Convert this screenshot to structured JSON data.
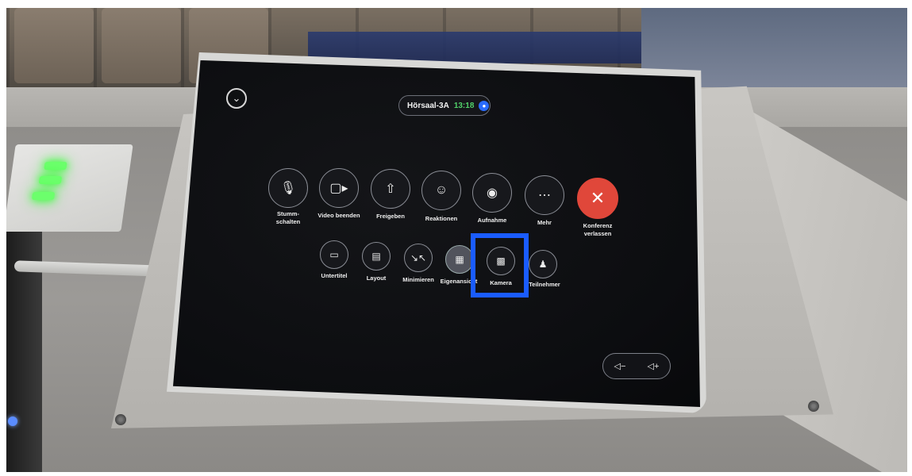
{
  "status": {
    "room": "Hörsaal-3A",
    "time": "13:18",
    "indicator_icon": "circle-dot-icon"
  },
  "top_controls": [
    {
      "id": "mute",
      "label": "Stumm-\nschalten",
      "icon": "microphone-icon"
    },
    {
      "id": "video",
      "label": "Video beenden",
      "icon": "video-camera-icon"
    },
    {
      "id": "share",
      "label": "Freigeben",
      "icon": "share-icon"
    },
    {
      "id": "reactions",
      "label": "Reaktionen",
      "icon": "smiley-icon"
    },
    {
      "id": "record",
      "label": "Aufnahme",
      "icon": "record-icon"
    },
    {
      "id": "more",
      "label": "Mehr",
      "icon": "ellipsis-icon"
    },
    {
      "id": "leave",
      "label": "Konferenz\nverlassen",
      "icon": "close-icon"
    }
  ],
  "bottom_controls": [
    {
      "id": "captions",
      "label": "Untertitel",
      "icon": "captions-icon"
    },
    {
      "id": "layout",
      "label": "Layout",
      "icon": "layout-icon"
    },
    {
      "id": "minimize",
      "label": "Minimieren",
      "icon": "minimize-icon"
    },
    {
      "id": "selfview",
      "label": "Eigenansicht",
      "icon": "self-view-icon"
    },
    {
      "id": "camera",
      "label": "Kamera",
      "icon": "camera-icon"
    },
    {
      "id": "participants",
      "label": "Teilnehmer",
      "icon": "person-icon"
    }
  ],
  "volume": {
    "down_icon": "volume-down-icon",
    "up_icon": "volume-up-icon"
  },
  "colors": {
    "leave_button": "#e0473a",
    "time_text": "#51d26a",
    "highlight_box": "#1a5cff"
  }
}
